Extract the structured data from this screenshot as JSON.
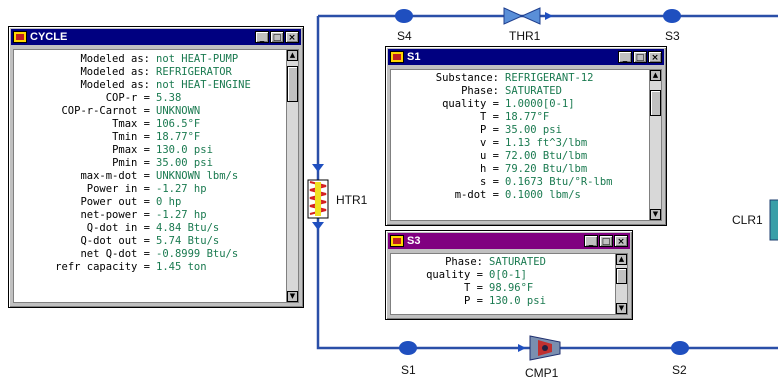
{
  "diagram": {
    "nodes": {
      "s4": "S4",
      "thr1": "THR1",
      "s3": "S3",
      "htr1": "HTR1",
      "clr1": "CLR1",
      "s1": "S1",
      "cmp1": "CMP1",
      "s2": "S2"
    },
    "colors": {
      "line": "#2a4fa8",
      "node": "#1f4fbf"
    }
  },
  "cycle_window": {
    "title": "CYCLE",
    "rows": [
      {
        "label": "Modeled as:",
        "value": "not HEAT-PUMP"
      },
      {
        "label": "Modeled as:",
        "value": "REFRIGERATOR"
      },
      {
        "label": "Modeled as:",
        "value": "not HEAT-ENGINE"
      },
      {
        "label": "COP-r =",
        "value": "5.38"
      },
      {
        "label": "COP-r-Carnot =",
        "value": "UNKNOWN"
      },
      {
        "label": "Tmax =",
        "value": "106.5°F"
      },
      {
        "label": "Tmin =",
        "value": "18.77°F"
      },
      {
        "label": "Pmax =",
        "value": "130.0 psi"
      },
      {
        "label": "Pmin =",
        "value": "35.00 psi"
      },
      {
        "label": "max-m-dot =",
        "value": "UNKNOWN lbm/s"
      },
      {
        "label": "Power in =",
        "value": "-1.27 hp"
      },
      {
        "label": "Power out =",
        "value": "0 hp"
      },
      {
        "label": "net-power =",
        "value": "-1.27 hp"
      },
      {
        "label": "Q-dot in =",
        "value": "4.84 Btu/s"
      },
      {
        "label": "Q-dot out =",
        "value": "5.74 Btu/s"
      },
      {
        "label": "net Q-dot =",
        "value": "-0.8999 Btu/s"
      },
      {
        "label": "refr capacity =",
        "value": "1.45 ton"
      }
    ]
  },
  "s1_window": {
    "title": "S1",
    "rows": [
      {
        "label": "Substance:",
        "value": "REFRIGERANT-12"
      },
      {
        "label": "Phase:",
        "value": "SATURATED"
      },
      {
        "label": "quality =",
        "value": "1.0000[0-1]"
      },
      {
        "label": "T =",
        "value": "18.77°F"
      },
      {
        "label": "P =",
        "value": "35.00 psi"
      },
      {
        "label": "v =",
        "value": "1.13 ft^3/lbm"
      },
      {
        "label": "u =",
        "value": "72.00 Btu/lbm"
      },
      {
        "label": "h =",
        "value": "79.20 Btu/lbm"
      },
      {
        "label": "s =",
        "value": "0.1673 Btu/°R-lbm"
      },
      {
        "label": "m-dot =",
        "value": "0.1000 lbm/s"
      }
    ]
  },
  "s3_window": {
    "title": "S3",
    "rows": [
      {
        "label": "Phase:",
        "value": "SATURATED"
      },
      {
        "label": "quality =",
        "value": "0[0-1]"
      },
      {
        "label": "T =",
        "value": "98.96°F"
      },
      {
        "label": "P =",
        "value": "130.0 psi"
      }
    ]
  }
}
